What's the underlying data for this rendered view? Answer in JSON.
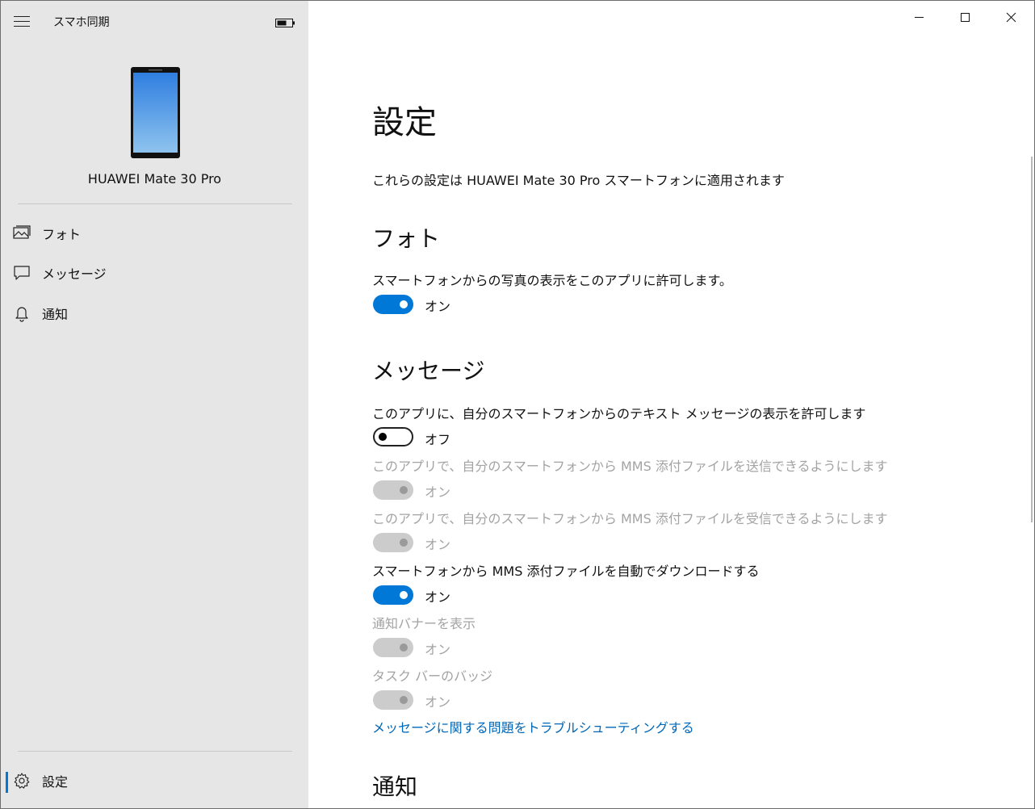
{
  "app": {
    "title": "スマホ同期"
  },
  "device": {
    "name": "HUAWEI Mate 30 Pro"
  },
  "nav": {
    "photos": "フォト",
    "messages": "メッセージ",
    "notifications": "通知",
    "settings": "設定"
  },
  "page": {
    "title": "設定",
    "subtitle": "これらの設定は HUAWEI Mate 30 Pro スマートフォンに適用されます"
  },
  "photos_section": {
    "title": "フォト",
    "allow_photos": {
      "label": "スマートフォンからの写真の表示をこのアプリに許可します。",
      "state": "オン"
    }
  },
  "messages_section": {
    "title": "メッセージ",
    "allow_messages": {
      "label": "このアプリに、自分のスマートフォンからのテキスト メッセージの表示を許可します",
      "state": "オフ"
    },
    "send_mms": {
      "label": "このアプリで、自分のスマートフォンから MMS 添付ファイルを送信できるようにします",
      "state": "オン"
    },
    "receive_mms": {
      "label": "このアプリで、自分のスマートフォンから MMS 添付ファイルを受信できるようにします",
      "state": "オン"
    },
    "auto_download_mms": {
      "label": "スマートフォンから MMS 添付ファイルを自動でダウンロードする",
      "state": "オン"
    },
    "notification_banner": {
      "label": "通知バナーを表示",
      "state": "オン"
    },
    "taskbar_badge": {
      "label": "タスク バーのバッジ",
      "state": "オン"
    },
    "troubleshoot_link": "メッセージに関する問題をトラブルシューティングする"
  },
  "notifications_section": {
    "title": "通知"
  },
  "colors": {
    "accent": "#0078d7",
    "sidebar_bg": "#e6e6e6",
    "link": "#0067b8"
  }
}
